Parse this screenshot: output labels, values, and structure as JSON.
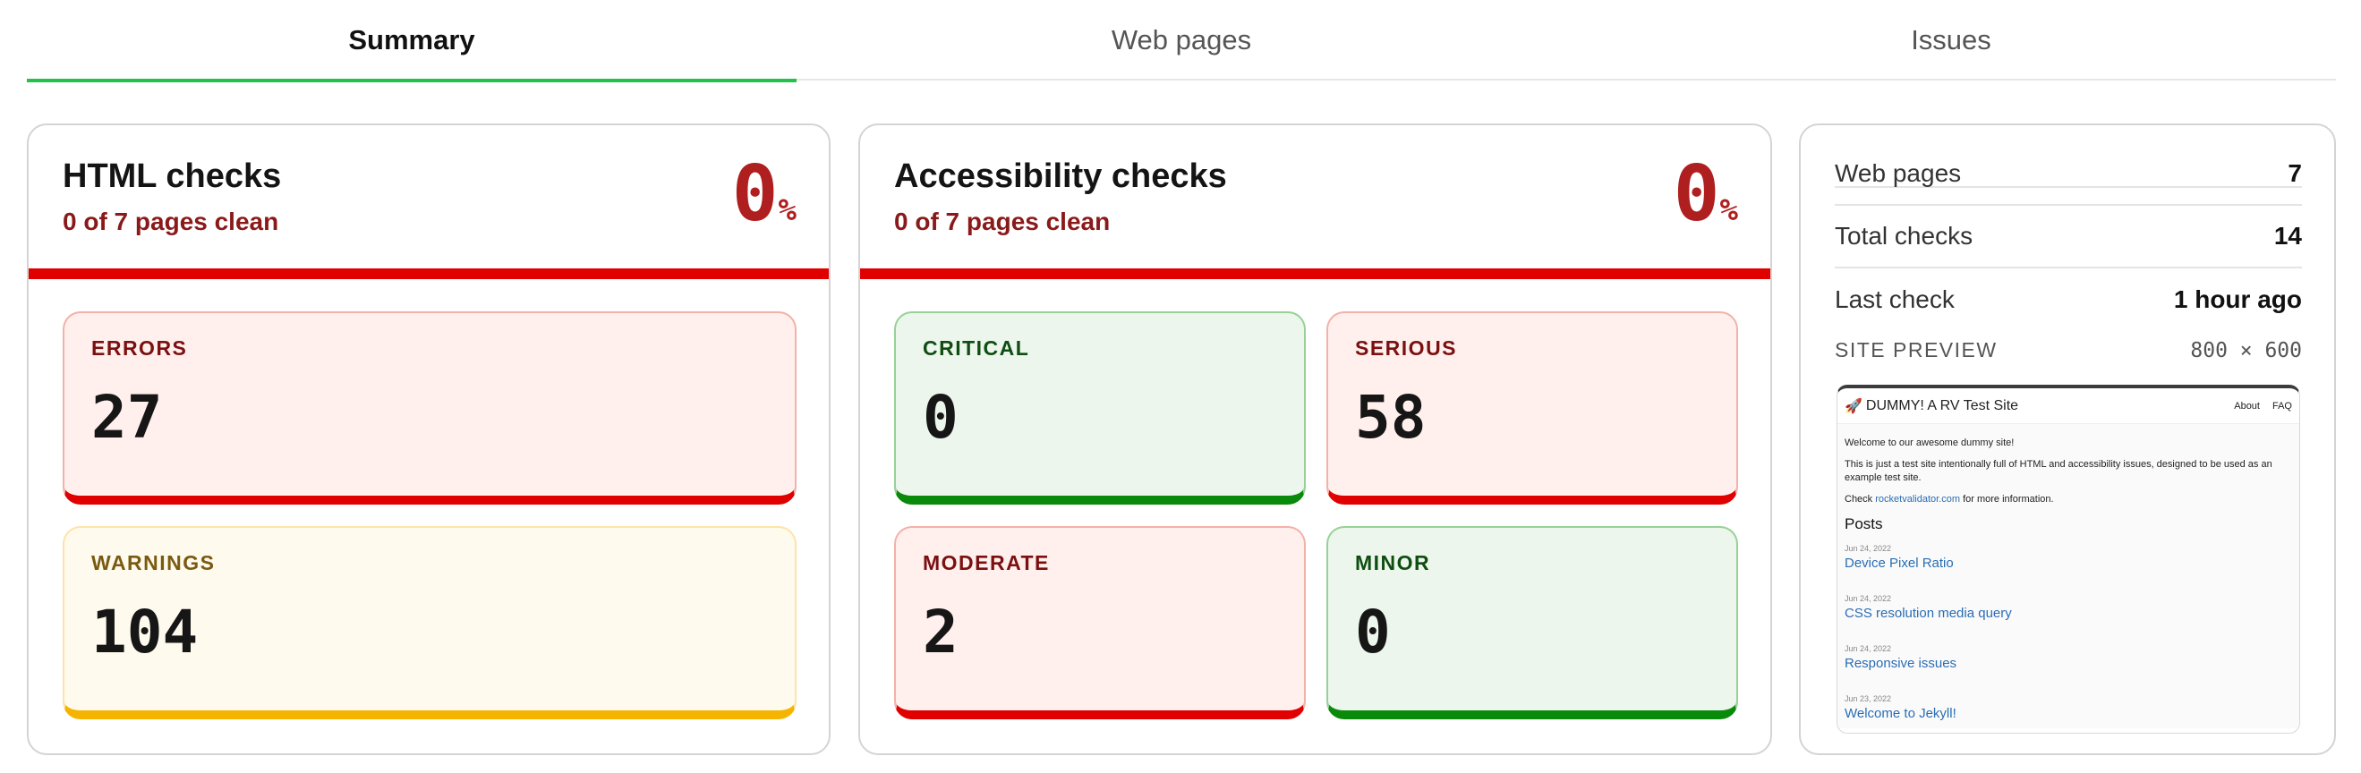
{
  "tabs": [
    {
      "label": "Summary",
      "active": true
    },
    {
      "label": "Web pages",
      "active": false
    },
    {
      "label": "Issues",
      "active": false
    }
  ],
  "html_card": {
    "title": "HTML checks",
    "subtitle": "0 of 7 pages clean",
    "percent": "0",
    "percent_symbol": "%",
    "errors": {
      "label": "ERRORS",
      "value": "27"
    },
    "warnings": {
      "label": "WARNINGS",
      "value": "104"
    }
  },
  "a11y_card": {
    "title": "Accessibility checks",
    "subtitle": "0 of 7 pages clean",
    "percent": "0",
    "percent_symbol": "%",
    "critical": {
      "label": "CRITICAL",
      "value": "0"
    },
    "serious": {
      "label": "SERIOUS",
      "value": "58"
    },
    "moderate": {
      "label": "MODERATE",
      "value": "2"
    },
    "minor": {
      "label": "MINOR",
      "value": "0"
    }
  },
  "side_card": {
    "stats": [
      {
        "label": "Web pages",
        "value": "7"
      },
      {
        "label": "Total checks",
        "value": "14"
      },
      {
        "label": "Last check",
        "value": "1 hour ago"
      }
    ],
    "preview_title": "SITE PREVIEW",
    "preview_dims": "800 × 600",
    "preview": {
      "brand_icon": "rocket-icon",
      "brand": "DUMMY! A RV Test Site",
      "nav_links": [
        "About",
        "FAQ"
      ],
      "welcome": "Welcome to our awesome dummy site!",
      "intro": "This is just a test site intentionally full of HTML and accessibility issues, designed to be used as an example test site.",
      "check_prefix": "Check",
      "check_link": "rocketvalidator.com",
      "check_suffix": "for more information.",
      "posts_heading": "Posts",
      "posts": [
        {
          "date": "Jun 24, 2022",
          "title": "Device Pixel Ratio"
        },
        {
          "date": "Jun 24, 2022",
          "title": "CSS resolution media query"
        },
        {
          "date": "Jun 24, 2022",
          "title": "Responsive issues"
        },
        {
          "date": "Jun 23, 2022",
          "title": "Welcome to Jekyll!"
        }
      ]
    }
  },
  "colors": {
    "tab_active": "#21c24a",
    "danger": "#e10000",
    "warning": "#f5b400",
    "success": "#0a8a0a",
    "percent": "#b01f1f"
  }
}
